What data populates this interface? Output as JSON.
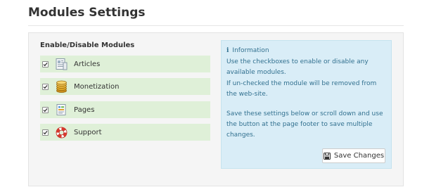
{
  "page": {
    "title": "Modules Settings"
  },
  "modules_section": {
    "title": "Enable/Disable Modules",
    "items": [
      {
        "label": "Articles",
        "checked": true,
        "icon": "articles-icon"
      },
      {
        "label": "Monetization",
        "checked": true,
        "icon": "coins-icon"
      },
      {
        "label": "Pages",
        "checked": true,
        "icon": "pages-icon"
      },
      {
        "label": "Support",
        "checked": true,
        "icon": "lifebuoy-icon"
      }
    ]
  },
  "info": {
    "heading": "Information",
    "icon": "info-icon",
    "para1": "Use the checkboxes to enable or disable any available modules.",
    "para2": "If un-checked the module will be removed from the web-site.",
    "para3": "Save these settings below or scroll down and use the button at the page footer to save multiple changes."
  },
  "save_button": {
    "label": "Save Changes",
    "icon": "floppy-disk-icon"
  },
  "colors": {
    "row_bg": "#dff0d8",
    "info_bg": "#d9edf7",
    "info_text": "#31708f",
    "panel_bg": "#f5f5f5"
  }
}
